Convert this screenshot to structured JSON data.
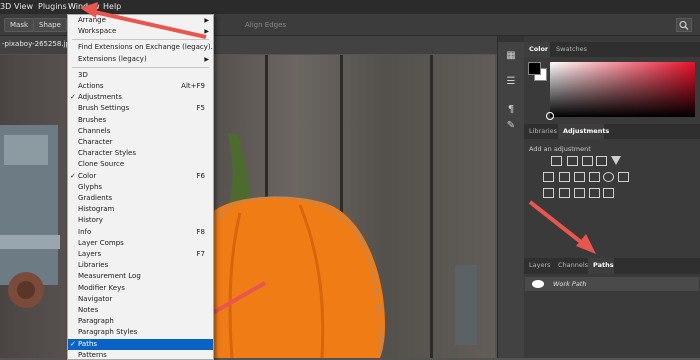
{
  "menubar": {
    "items": [
      "3D",
      "View",
      "Plugins",
      "Window",
      "Help"
    ]
  },
  "options_bar": {
    "mask_label": "Mask",
    "shape_label": "Shape",
    "faint_label": "Align Edges"
  },
  "document": {
    "tab_title": "-pixaboy-265258.jpg"
  },
  "window_menu": {
    "items": [
      {
        "label": "Arrange",
        "shortcut": "",
        "checked": false,
        "submenu": true
      },
      {
        "label": "Workspace",
        "shortcut": "",
        "checked": false,
        "submenu": true
      },
      {
        "label": "Find Extensions on Exchange (legacy)...",
        "shortcut": "",
        "checked": false,
        "submenu": false
      },
      {
        "label": "Extensions (legacy)",
        "shortcut": "",
        "checked": false,
        "submenu": true
      },
      {
        "label": "3D",
        "shortcut": "",
        "checked": false,
        "submenu": false
      },
      {
        "label": "Actions",
        "shortcut": "Alt+F9",
        "checked": false,
        "submenu": false
      },
      {
        "label": "Adjustments",
        "shortcut": "",
        "checked": true,
        "submenu": false
      },
      {
        "label": "Brush Settings",
        "shortcut": "F5",
        "checked": false,
        "submenu": false
      },
      {
        "label": "Brushes",
        "shortcut": "",
        "checked": false,
        "submenu": false
      },
      {
        "label": "Channels",
        "shortcut": "",
        "checked": false,
        "submenu": false
      },
      {
        "label": "Character",
        "shortcut": "",
        "checked": false,
        "submenu": false
      },
      {
        "label": "Character Styles",
        "shortcut": "",
        "checked": false,
        "submenu": false
      },
      {
        "label": "Clone Source",
        "shortcut": "",
        "checked": false,
        "submenu": false
      },
      {
        "label": "Color",
        "shortcut": "F6",
        "checked": true,
        "submenu": false
      },
      {
        "label": "Glyphs",
        "shortcut": "",
        "checked": false,
        "submenu": false
      },
      {
        "label": "Gradients",
        "shortcut": "",
        "checked": false,
        "submenu": false
      },
      {
        "label": "Histogram",
        "shortcut": "",
        "checked": false,
        "submenu": false
      },
      {
        "label": "History",
        "shortcut": "",
        "checked": false,
        "submenu": false
      },
      {
        "label": "Info",
        "shortcut": "F8",
        "checked": false,
        "submenu": false
      },
      {
        "label": "Layer Comps",
        "shortcut": "",
        "checked": false,
        "submenu": false
      },
      {
        "label": "Layers",
        "shortcut": "F7",
        "checked": false,
        "submenu": false
      },
      {
        "label": "Libraries",
        "shortcut": "",
        "checked": false,
        "submenu": false
      },
      {
        "label": "Measurement Log",
        "shortcut": "",
        "checked": false,
        "submenu": false
      },
      {
        "label": "Modifier Keys",
        "shortcut": "",
        "checked": false,
        "submenu": false
      },
      {
        "label": "Navigator",
        "shortcut": "",
        "checked": false,
        "submenu": false
      },
      {
        "label": "Notes",
        "shortcut": "",
        "checked": false,
        "submenu": false
      },
      {
        "label": "Paragraph",
        "shortcut": "",
        "checked": false,
        "submenu": false
      },
      {
        "label": "Paragraph Styles",
        "shortcut": "",
        "checked": false,
        "submenu": false
      },
      {
        "label": "Paths",
        "shortcut": "",
        "checked": true,
        "submenu": false,
        "highlighted": true
      },
      {
        "label": "Patterns",
        "shortcut": "",
        "checked": false,
        "submenu": false
      }
    ]
  },
  "color_panel": {
    "tabs": [
      "Color",
      "Swatches"
    ]
  },
  "adjustments_panel": {
    "tabs": [
      "Libraries",
      "Adjustments"
    ],
    "hint": "Add an adjustment"
  },
  "layers_panel": {
    "tabs": [
      "Layers",
      "Channels",
      "Paths"
    ],
    "path_item": "Work Path"
  },
  "colors": {
    "accent": "#0a63c4",
    "arrow": "#e8574f",
    "pumpkin": "#f07c16"
  }
}
